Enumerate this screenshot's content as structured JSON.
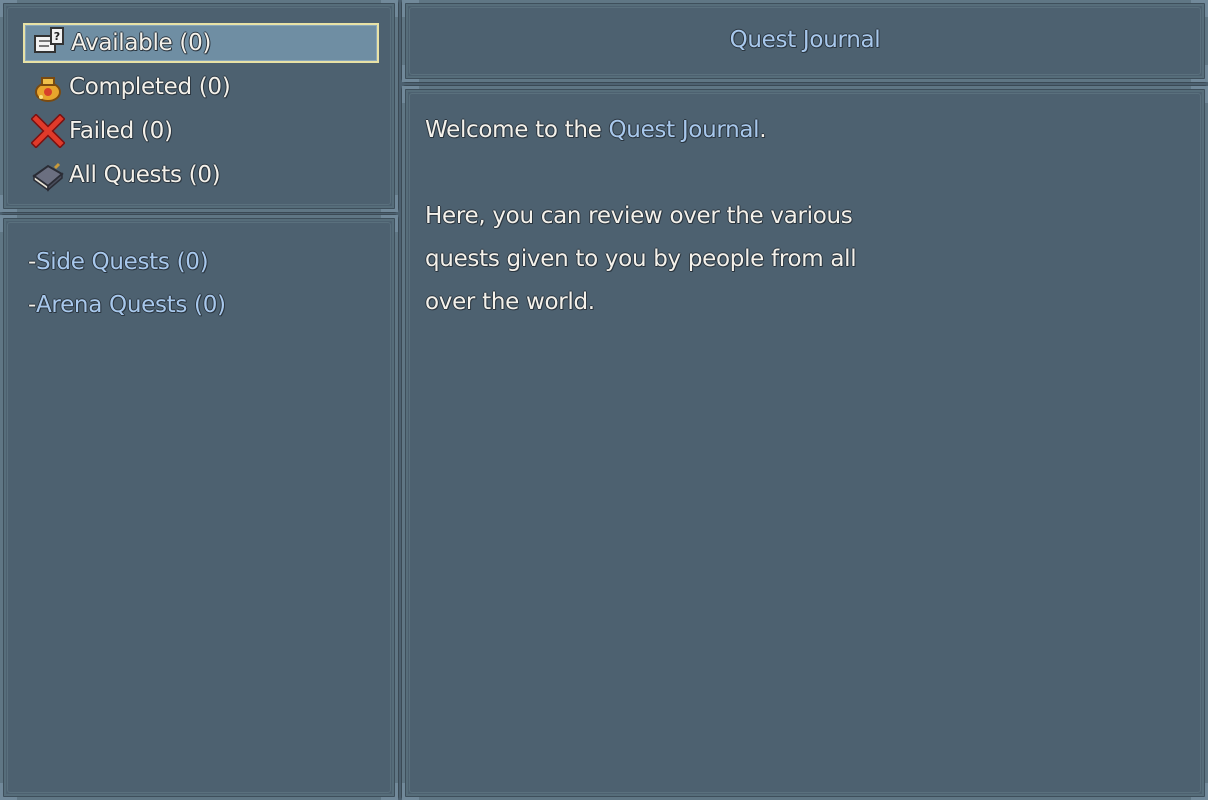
{
  "categories": [
    {
      "label": "Available (0)",
      "icon": "quest-board-icon",
      "selected": true
    },
    {
      "label": "Completed (0)",
      "icon": "treasure-pouch-icon",
      "selected": false
    },
    {
      "label": "Failed (0)",
      "icon": "red-x-icon",
      "selected": false
    },
    {
      "label": "All Quests (0)",
      "icon": "book-icon",
      "selected": false
    }
  ],
  "types": [
    {
      "prefix": "-",
      "label": "Side Quests (0)"
    },
    {
      "prefix": "-",
      "label": "Arena Quests (0)"
    }
  ],
  "journal": {
    "title": "Quest Journal",
    "welcome_prefix": "Welcome to the ",
    "welcome_highlight": "Quest Journal",
    "welcome_suffix": ".",
    "lines": [
      "Here, you can review over the various",
      "quests given to you by people from all",
      "over the world."
    ]
  },
  "colors": {
    "window_bg": "#4d6170",
    "highlight_text": "#a8c8ec",
    "selection_bg": "#6f8ea3",
    "selection_border": "#e8e2a6"
  }
}
